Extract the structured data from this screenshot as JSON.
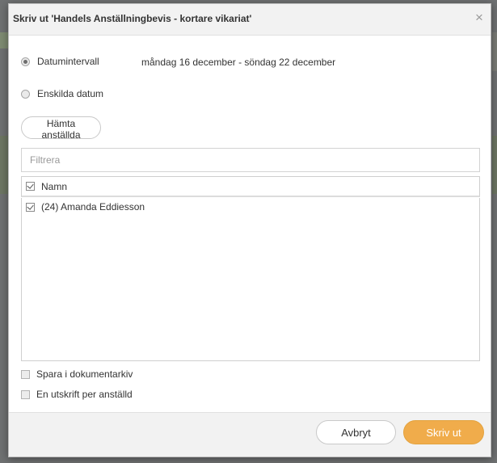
{
  "dialog": {
    "title": "Skriv ut 'Handels Anställningbevis - kortare vikariat'",
    "close_symbol": "×"
  },
  "date_mode": {
    "interval_label": "Datumintervall",
    "interval_selected": true,
    "date_range": "måndag 16 december - söndag 22 december",
    "single_dates_label": "Enskilda datum"
  },
  "fetch_button": {
    "label": "Hämta anställda"
  },
  "filter": {
    "placeholder": "Filtrera",
    "value": ""
  },
  "employee_list": {
    "header_label": "Namn",
    "header_checked": true,
    "rows": [
      {
        "label": "(24) Amanda Eddiesson",
        "checked": true
      }
    ]
  },
  "options": {
    "save_archive_label": "Spara i dokumentarkiv",
    "one_print_label": "En utskrift per anställd"
  },
  "footer": {
    "cancel_label": "Avbryt",
    "print_label": "Skriv ut"
  },
  "colors": {
    "primary_button": "#f0ac4b",
    "header_bg": "#f2f2f2"
  }
}
